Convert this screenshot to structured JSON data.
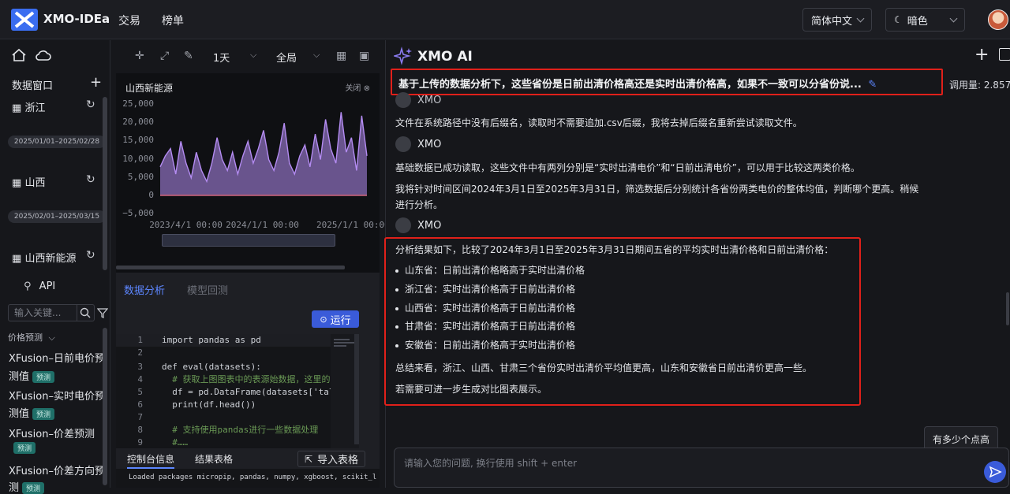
{
  "header": {
    "brand": "XMO-IDEa",
    "nav": [
      "交易",
      "榜单"
    ],
    "language": "简体中文",
    "theme": "暗色"
  },
  "sidebar": {
    "section_title": "数据窗口",
    "windows": [
      {
        "label": "浙江",
        "date": "2025/01/01–2025/02/28"
      },
      {
        "label": "山西",
        "date": "2025/02/01–2025/03/15"
      },
      {
        "label": "山西新能源"
      }
    ],
    "api_label": "API",
    "search_placeholder": "输入关键...",
    "category": "价格预测",
    "models": [
      {
        "line1": "XFusion–日前电价预",
        "line2": "测值",
        "badge": "预测"
      },
      {
        "line1": "XFusion–实时电价预",
        "line2": "测值",
        "badge": "预测"
      },
      {
        "line1": "XFusion–价差预测",
        "line2": "",
        "badge": "预测"
      },
      {
        "line1": "XFusion–价差方向预",
        "line2": "测",
        "badge": "预测"
      }
    ]
  },
  "toolbar": {
    "period": "1天",
    "scope": "全局"
  },
  "chart_panel": {
    "title": "山西新能源",
    "close_label": "关闭 ⊗"
  },
  "chart_data": {
    "type": "line",
    "title": "",
    "xlabel": "",
    "ylabel": "",
    "ylim": [
      -5000,
      25000
    ],
    "y_ticks": [
      "25,000",
      "20,000",
      "15,000",
      "10,000",
      "5,000",
      "0",
      "−5,000"
    ],
    "x_ticks": [
      "2023/4/1 00:00",
      "2024/1/1 00:00",
      "2025/1/1 00:00"
    ],
    "series": [
      {
        "color": "#b48cf2",
        "values": [
          8000,
          11000,
          13000,
          6000,
          15000,
          9000,
          5000,
          12000,
          7000,
          4000,
          9000,
          16000,
          10000,
          7000,
          12000,
          6000,
          11000,
          15000,
          9000,
          13000,
          18000,
          10000,
          7000,
          12000,
          20000,
          9000,
          6000,
          11000,
          14000,
          8000,
          17000,
          10000,
          21000,
          13000,
          9000,
          23000,
          12000,
          16000,
          7000,
          22000,
          11000
        ]
      },
      {
        "color": "#e0626a",
        "values": [
          200,
          200,
          200,
          200,
          200,
          200,
          200,
          200,
          200,
          200,
          200,
          200,
          200,
          200,
          200,
          200,
          200,
          200,
          200,
          200,
          200,
          200,
          200,
          200,
          200,
          200,
          200,
          200,
          200,
          200,
          200,
          200,
          200,
          200,
          200,
          200,
          200,
          200,
          200,
          200,
          200
        ]
      }
    ]
  },
  "editor": {
    "tabs": [
      "数据分析",
      "模型回测"
    ],
    "run_label": "运行",
    "lines": [
      {
        "n": "1",
        "code": "import pandas as pd"
      },
      {
        "n": "2",
        "code": ""
      },
      {
        "n": "3",
        "code": "def eval(datasets):"
      },
      {
        "n": "4",
        "code": "  # 获取上图图表中的表源始数据，这里的"
      },
      {
        "n": "5",
        "code": "  df = pd.DataFrame(datasets['tal"
      },
      {
        "n": "6",
        "code": "  print(df.head())"
      },
      {
        "n": "7",
        "code": ""
      },
      {
        "n": "8",
        "code": "  # 支持使用pandas进行一些数据处理"
      },
      {
        "n": "9",
        "code": "  #……"
      }
    ],
    "console_tabs": [
      "控制台信息",
      "结果表格"
    ],
    "import_label": "导入表格",
    "console_output": "Loaded packages micropip, pandas, numpy, xgboost, scikit_l"
  },
  "chat": {
    "title": "XMO AI",
    "question": "基于上传的数据分析下，这些省份是日前出清价格高还是实时出清价格高，如果不一致可以分省份说...",
    "usage": "调用量: 2.857",
    "sender": "XMO",
    "msg1": "文件在系统路径中没有后缀名，读取时不需要追加.csv后缀，我将去掉后缀名重新尝试读取文件。",
    "msg2": "基础数据已成功读取，这些文件中有两列分别是“实时出清电价”和“日前出清电价”，可以用于比较这两类价格。",
    "msg3a": "我将针对时间区间2024年3月1日至2025年3月31日，筛选数据后分别统计各省份两类电价的整体均值，判断哪个更高。稍候",
    "msg3b": "进行分析。",
    "result_intro": "分析结果如下，比较了2024年3月1日至2025年3月31日期间五省的平均实时出清价格和日前出清价格：",
    "bullets": [
      "山东省：日前出清价格略高于实时出清价格",
      "浙江省：实时出清价格高于日前出清价格",
      "山西省：实时出清价格高于日前出清价格",
      "甘肃省：实时出清价格高于日前出清价格",
      "安徽省：日前出清价格高于实时出清价格"
    ],
    "summary": "总结来看，浙江、山西、甘肃三个省份实时出清价平均值更高，山东和安徽省日前出清价更高一些。",
    "followup": "若需要可进一步生成对比图表展示。",
    "suggestion": "有多少个点高",
    "input_placeholder": "请输入您的问题, 换行使用 shift + enter"
  }
}
